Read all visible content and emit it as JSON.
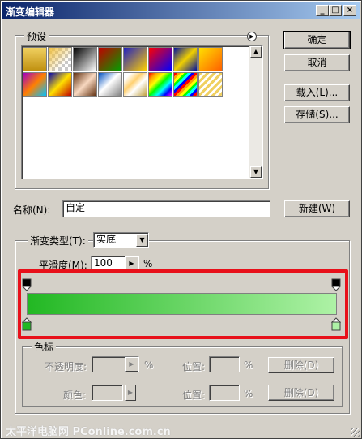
{
  "window": {
    "title": "渐变编辑器"
  },
  "titlebar_buttons": {
    "minimize": "_",
    "maximize": "□",
    "close": "×"
  },
  "presets": {
    "label": "预设",
    "swatches_row1": [
      "linear-gradient(to bottom, #f0d060, #c09010)",
      "checker-fg",
      "linear-gradient(135deg, #000, #fff)",
      "linear-gradient(135deg, #c00000, #00a000)",
      "linear-gradient(135deg, #2020c0, #ffd000)",
      "linear-gradient(135deg, #ff0000, #0000ff)",
      "linear-gradient(135deg, #0010a0, #f0d000 50%, #0010a0)",
      "linear-gradient(135deg, #ffe000, #ff6000)"
    ],
    "swatches_row2": [
      "linear-gradient(135deg, #a000c0, #ff8000, #00c0ff)",
      "linear-gradient(135deg, #0000b0, #ffe000 50%, #c00000)",
      "linear-gradient(135deg, #603010, #f8d8c0 50%, #603010)",
      "linear-gradient(135deg, #0050c0, #fff 45%, #808080)",
      "linear-gradient(135deg, #fff 15%, #ffd070 40%, #fff 60%, #c0a040)",
      "linear-gradient(135deg, red, orange, yellow, lime, cyan, blue, magenta)",
      "repeating-linear-gradient(135deg, red 0 3px, orange 3px 6px, yellow 6px 9px, lime 9px 12px, cyan 12px 15px, blue 15px 18px)",
      "repeating-linear-gradient(135deg, #f0d060 0 3px, #fff 3px 6px)"
    ],
    "menu_icon": "right-arrow-circle-icon"
  },
  "buttons": {
    "ok": "确定",
    "cancel": "取消",
    "load": "载入(L)...",
    "save": "存储(S)...",
    "new": "新建(W)"
  },
  "name_field": {
    "label": "名称(N):",
    "value": "自定"
  },
  "gradient_type": {
    "label": "渐变类型(T):",
    "value": "实底"
  },
  "smoothness": {
    "label": "平滑度(M):",
    "value": "100",
    "unit": "%"
  },
  "gradient": {
    "start_color": "#22b823",
    "end_color": "#aef2a6"
  },
  "stops": {
    "label": "色标",
    "opacity_label": "不透明度:",
    "opacity_unit": "%",
    "color_label": "颜色:",
    "location_label": "位置:",
    "location_unit": "%",
    "delete_label": "删除(D)"
  },
  "watermark": "太平洋电脑网 PConline.com.cn"
}
